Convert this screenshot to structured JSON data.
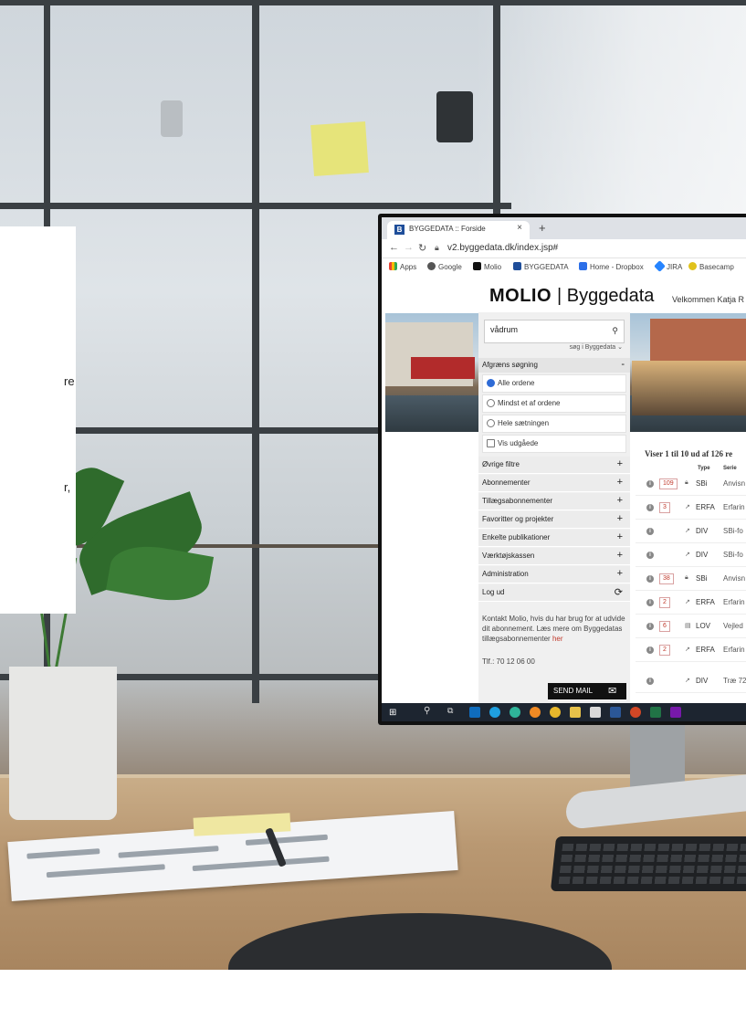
{
  "card": {
    "line1": "re",
    "line2": "r,"
  },
  "browser": {
    "tab_title": "BYGGEDATA :: Forside",
    "tab_favicon": "B",
    "tab_close": "×",
    "new_tab": "+",
    "url": "v2.byggedata.dk/index.jsp#",
    "bookmarks": [
      "Apps",
      "Google",
      "Molio",
      "BYGGEDATA",
      "Home - Dropbox",
      "JIRA",
      "Basecamp"
    ]
  },
  "site": {
    "logo_strong": "MOLIO",
    "logo_rest": "| Byggedata",
    "welcome": "Velkommen Katja R"
  },
  "search": {
    "value": "vådrum",
    "scope": "søg i Byggedata ⌄"
  },
  "filter": {
    "title": "Afgræns søgning",
    "toggle": "-",
    "options": [
      "Alle ordene",
      "Mindst et af ordene",
      "Hele sætningen",
      "Vis udgåede"
    ],
    "selected_option": "Alle ordene"
  },
  "menu": [
    {
      "label": "Øvrige filtre",
      "icon": "+"
    },
    {
      "label": "Abonnementer",
      "icon": "+"
    },
    {
      "label": "Tillægsabonnementer",
      "icon": "+"
    },
    {
      "label": "Favoritter og projekter",
      "icon": "+"
    },
    {
      "label": "Enkelte publikationer",
      "icon": "+"
    },
    {
      "label": "Værktøjskassen",
      "icon": "+"
    },
    {
      "label": "Administration",
      "icon": "+"
    },
    {
      "label": "Log ud",
      "icon": "⟳"
    }
  ],
  "contact": {
    "text": "Kontakt Molio, hvis du har brug for at udvide dit abonnement. Læs mere om Byggedatas tillægsabonnementer ",
    "link": "her",
    "phone": "Tlf.: 70 12 06 00",
    "send_mail": "SEND MAIL"
  },
  "results": {
    "summary": "Viser 1 til 10 ud af 126 re",
    "headers": [
      "Type",
      "Serie"
    ],
    "rows": [
      {
        "count": "109",
        "icon": "lock-icon",
        "type": "SBi",
        "serie": "Anvisn"
      },
      {
        "count": "3",
        "icon": "external-link-icon",
        "type": "ERFA",
        "serie": "Erfarin"
      },
      {
        "count": "",
        "icon": "external-link-icon",
        "type": "DIV",
        "serie": "SBi-fo"
      },
      {
        "count": "",
        "icon": "external-link-icon",
        "type": "DIV",
        "serie": "SBi-fo"
      },
      {
        "count": "38",
        "icon": "lock-icon",
        "type": "SBi",
        "serie": "Anvisn"
      },
      {
        "count": "2",
        "icon": "external-link-icon",
        "type": "ERFA",
        "serie": "Erfarin"
      },
      {
        "count": "6",
        "icon": "document-icon",
        "type": "LOV",
        "serie": "Vejled"
      },
      {
        "count": "2",
        "icon": "external-link-icon",
        "type": "ERFA",
        "serie": "Erfarin"
      },
      {
        "count": "",
        "icon": "external-link-icon",
        "type": "DIV",
        "serie": "Træ 72"
      }
    ]
  },
  "colors": {
    "accent_red": "#c0392b",
    "radio_blue": "#2e6bd6",
    "taskbar": "#1d2530"
  }
}
